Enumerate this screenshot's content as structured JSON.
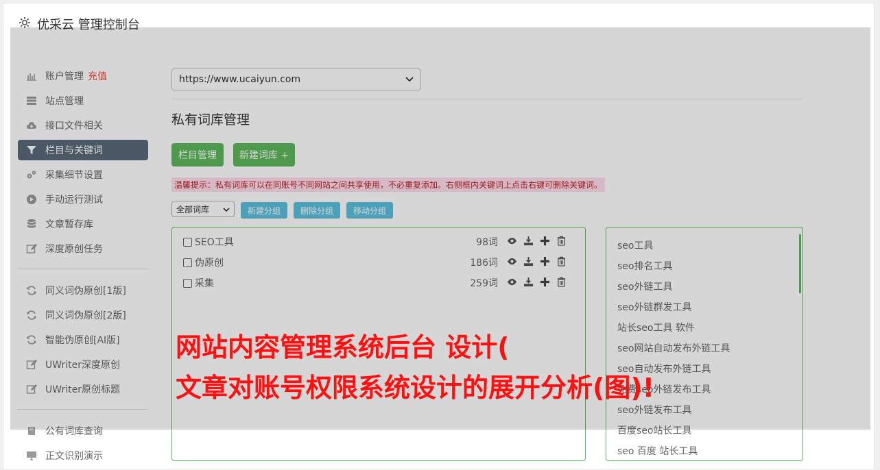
{
  "app": {
    "title": "优采云 管理控制台",
    "icon": "gear-icon"
  },
  "sidebar": {
    "group1": [
      {
        "label": "账户管理",
        "badge": "充值",
        "icon": "bar-chart-icon"
      },
      {
        "label": "站点管理",
        "icon": "server-icon"
      },
      {
        "label": "接口文件相关",
        "icon": "cloud-upload-icon"
      },
      {
        "label": "栏目与关键词",
        "icon": "filter-icon",
        "active": true
      },
      {
        "label": "采集细节设置",
        "icon": "gears-icon"
      },
      {
        "label": "手动运行测试",
        "icon": "play-circle-icon"
      },
      {
        "label": "文章暂存库",
        "icon": "database-icon"
      },
      {
        "label": "深度原创任务",
        "icon": "edit-icon"
      }
    ],
    "group2": [
      {
        "label": "同义词伪原创[1版]",
        "icon": "refresh-icon"
      },
      {
        "label": "同义词伪原创[2版]",
        "icon": "refresh-icon"
      },
      {
        "label": "智能伪原创[AI版]",
        "icon": "refresh-icon"
      },
      {
        "label": "UWriter深度原创",
        "icon": "edit-icon"
      },
      {
        "label": "UWriter原创标题",
        "icon": "edit-icon"
      }
    ],
    "group3": [
      {
        "label": "公有词库查询",
        "icon": "book-icon"
      },
      {
        "label": "正文识别演示",
        "icon": "monitor-icon"
      }
    ]
  },
  "main": {
    "site_select": "https://www.ucaiyun.com",
    "page_title": "私有词库管理",
    "btn_columns": "栏目管理",
    "btn_new_lib": "新建词库 +",
    "tip": "温馨提示：私有词库可以在同账号不同网站之间共享使用，不必重复添加。右侧框内关键词上点击右键可删除关键词。",
    "filter_select": "全部词库",
    "btn_new_group": "新建分组",
    "btn_del_group": "删除分组",
    "btn_move_group": "移动分组",
    "libraries": [
      {
        "name": "SEO工具",
        "count": "98词"
      },
      {
        "name": "伪原创",
        "count": "186词"
      },
      {
        "name": "采集",
        "count": "259词"
      }
    ],
    "keywords": [
      "seo工具",
      "seo排名工具",
      "seo外链工具",
      "seo外链群发工具",
      "站长seo工具 软件",
      "seo网站自动发布外链工具",
      "seo自动发布外链工具",
      "免费seo外链发布工具",
      "seo外链发布工具",
      "百度seo站长工具",
      "seo 百度 站长工具"
    ]
  },
  "overlay_text": {
    "line1": "网站内容管理系统后台 设计(",
    "line2": "文章对账号权限系统设计的展开分析(图)!"
  },
  "colors": {
    "green": "#5cb85c",
    "blue": "#5bc0de",
    "active_nav": "#5a6a7a",
    "headline": "#ff1010"
  }
}
